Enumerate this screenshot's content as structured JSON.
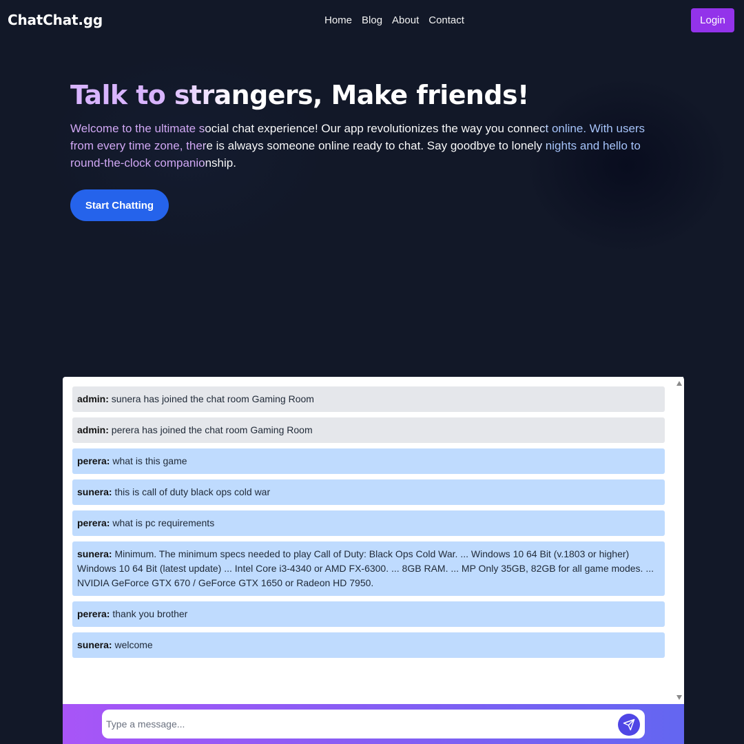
{
  "navbar": {
    "brand": "ChatChat.gg",
    "links": [
      "Home",
      "Blog",
      "About",
      "Contact"
    ],
    "login_label": "Login"
  },
  "hero": {
    "title": "Talk to strangers, Make friends!",
    "description": "Welcome to the ultimate social chat experience! Our app revolutionizes the way you connect online. With users from every time zone, there is always someone online ready to chat. Say goodbye to lonely nights and hello to round-the-clock companionship.",
    "cta_label": "Start Chatting"
  },
  "chat": {
    "messages": [
      {
        "sender": "admin:",
        "text": " sunera has joined the chat room Gaming Room",
        "role": "admin"
      },
      {
        "sender": "admin:",
        "text": " perera has joined the chat room Gaming Room",
        "role": "admin"
      },
      {
        "sender": "perera:",
        "text": " what is this game",
        "role": "user"
      },
      {
        "sender": "sunera:",
        "text": " this is call of duty black ops cold war",
        "role": "user"
      },
      {
        "sender": "perera:",
        "text": " what is pc requirements",
        "role": "user"
      },
      {
        "sender": "sunera:",
        "text": " Minimum. The minimum specs needed to play Call of Duty: Black Ops Cold War. ... Windows 10 64 Bit (v.1803 or higher) Windows 10 64 Bit (latest update) ... Intel Core i3-4340 or AMD FX-6300. ... 8GB RAM. ... MP Only 35GB, 82GB for all game modes. ... NVIDIA GeForce GTX 670 / GeForce GTX 1650 or Radeon HD 7950.",
        "role": "user"
      },
      {
        "sender": "perera:",
        "text": " thank you brother",
        "role": "user"
      },
      {
        "sender": "sunera:",
        "text": " welcome",
        "role": "user"
      }
    ],
    "input_placeholder": "Type a message...",
    "send_icon": "send-icon"
  },
  "colors": {
    "background": "#121828",
    "login": "#9333ea",
    "cta": "#2563eb",
    "admin_message": "#e5e7eb",
    "user_message": "#bfdbfe"
  }
}
